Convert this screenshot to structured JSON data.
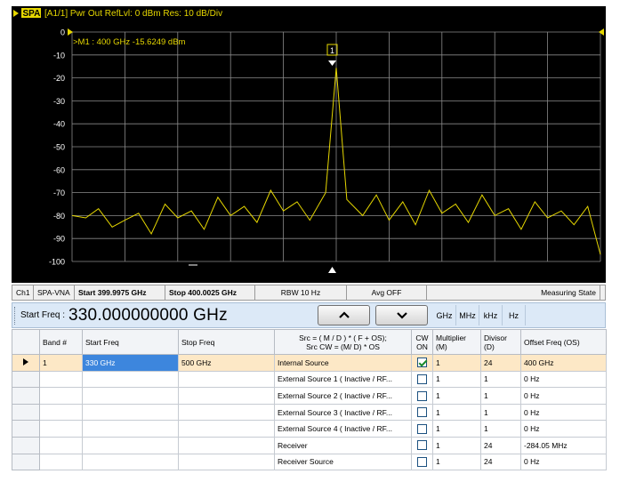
{
  "trace_header": {
    "tag": "SPA1",
    "info": "[A1/1]  Pwr Out RefLvl: 0  dBm Res: 10  dB/Div"
  },
  "marker": {
    "readout": ">M1 :  400 GHz  -15.6249  dBm",
    "number": "1"
  },
  "y_ticks": [
    "0",
    "-10",
    "-20",
    "-30",
    "-40",
    "-50",
    "-60",
    "-70",
    "-80",
    "-90",
    "-100"
  ],
  "chart_data": {
    "type": "line",
    "title": "",
    "xlabel": "",
    "ylabel": "",
    "xlim": [
      399.9975,
      400.0025
    ],
    "ylim": [
      -100,
      0
    ],
    "x_unit": "GHz",
    "y_unit": "dBm",
    "grid": true,
    "series": [
      {
        "color": "#e6d700",
        "points": [
          [
            399.9975,
            -80
          ],
          [
            399.99763,
            -81
          ],
          [
            399.99775,
            -77
          ],
          [
            399.99788,
            -85
          ],
          [
            399.998,
            -82
          ],
          [
            399.99813,
            -79
          ],
          [
            399.99825,
            -88
          ],
          [
            399.99838,
            -75
          ],
          [
            399.9985,
            -81
          ],
          [
            399.99863,
            -78
          ],
          [
            399.99875,
            -86
          ],
          [
            399.99888,
            -72
          ],
          [
            399.999,
            -80
          ],
          [
            399.99913,
            -76
          ],
          [
            399.99925,
            -83
          ],
          [
            399.99938,
            -69
          ],
          [
            399.9995,
            -78
          ],
          [
            399.99963,
            -74
          ],
          [
            399.99975,
            -82
          ],
          [
            399.9999,
            -70
          ],
          [
            400.0,
            -15.6249
          ],
          [
            400.0001,
            -73
          ],
          [
            400.00025,
            -80
          ],
          [
            400.00038,
            -71
          ],
          [
            400.0005,
            -82
          ],
          [
            400.00063,
            -74
          ],
          [
            400.00075,
            -84
          ],
          [
            400.00088,
            -69
          ],
          [
            400.001,
            -79
          ],
          [
            400.00113,
            -75
          ],
          [
            400.00125,
            -83
          ],
          [
            400.00138,
            -71
          ],
          [
            400.0015,
            -80
          ],
          [
            400.00163,
            -77
          ],
          [
            400.00175,
            -86
          ],
          [
            400.00188,
            -74
          ],
          [
            400.002,
            -81
          ],
          [
            400.00213,
            -78
          ],
          [
            400.00225,
            -84
          ],
          [
            400.00238,
            -76
          ],
          [
            400.0025,
            -97
          ]
        ]
      }
    ]
  },
  "status_bar": {
    "channel": "Ch1",
    "mode": "SPA-VNA",
    "start": "Start 399.9975 GHz",
    "stop": "Stop 400.0025 GHz",
    "rbw": "RBW 10  Hz",
    "avg": "Avg OFF",
    "state": "Measuring State"
  },
  "freq_toolbar": {
    "label": "Start Freq :",
    "value": "330.000000000 GHz",
    "units": [
      "GHz",
      "MHz",
      "kHz",
      "Hz"
    ]
  },
  "table": {
    "columns": [
      "Band #",
      "Start Freq",
      "Stop Freq",
      "Src = ( M / D ) * ( F + OS);\nSrc CW = (M/ D) * OS",
      "CW\nON",
      "Multiplier\n(M)",
      "Divisor\n(D)",
      "Offset Freq (OS)"
    ],
    "rows": [
      {
        "band": "1",
        "start": "330 GHz",
        "stop": "500 GHz",
        "source": "Internal Source",
        "cw_on": true,
        "multiplier": "1",
        "divisor": "24",
        "offset": "400 GHz"
      },
      {
        "band": "",
        "start": "",
        "stop": "",
        "source": "External Source 1 ( Inactive / RF...",
        "cw_on": false,
        "multiplier": "1",
        "divisor": "1",
        "offset": "0 Hz"
      },
      {
        "band": "",
        "start": "",
        "stop": "",
        "source": "External Source 2 ( Inactive / RF...",
        "cw_on": false,
        "multiplier": "1",
        "divisor": "1",
        "offset": "0 Hz"
      },
      {
        "band": "",
        "start": "",
        "stop": "",
        "source": "External Source 3 ( Inactive / RF...",
        "cw_on": false,
        "multiplier": "1",
        "divisor": "1",
        "offset": "0 Hz"
      },
      {
        "band": "",
        "start": "",
        "stop": "",
        "source": "External Source 4 ( Inactive / RF...",
        "cw_on": false,
        "multiplier": "1",
        "divisor": "1",
        "offset": "0 Hz"
      },
      {
        "band": "",
        "start": "",
        "stop": "",
        "source": "Receiver",
        "cw_on": false,
        "multiplier": "1",
        "divisor": "24",
        "offset": "-284.05 MHz"
      },
      {
        "band": "",
        "start": "",
        "stop": "",
        "source": "Receiver Source",
        "cw_on": false,
        "multiplier": "1",
        "divisor": "24",
        "offset": "0 Hz"
      }
    ]
  }
}
